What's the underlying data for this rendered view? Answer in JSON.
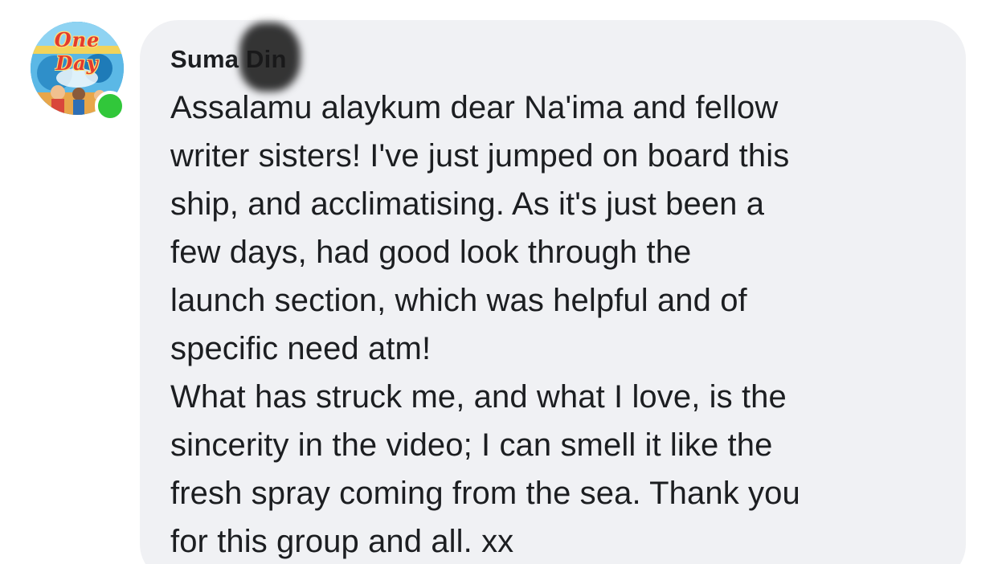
{
  "comment": {
    "author_first": "Suma",
    "author_last": "Din",
    "avatar_text": "One Day",
    "online": true,
    "message_lines": [
      "Assalamu alaykum dear Na'ima and fellow",
      "writer sisters! I've just jumped on board this",
      "ship, and acclimatising. As it's just been a",
      "few days, had  good look through the",
      "launch section, which was helpful and of",
      "specific need atm!",
      "What has struck me, and what I love, is the",
      "sincerity in the video; I can smell it like the",
      "fresh spray coming from the sea. Thank you",
      "for this group and all. xx"
    ]
  },
  "colors": {
    "bubble": "#f0f1f4",
    "text": "#1c1e21",
    "online": "#31c73a"
  }
}
